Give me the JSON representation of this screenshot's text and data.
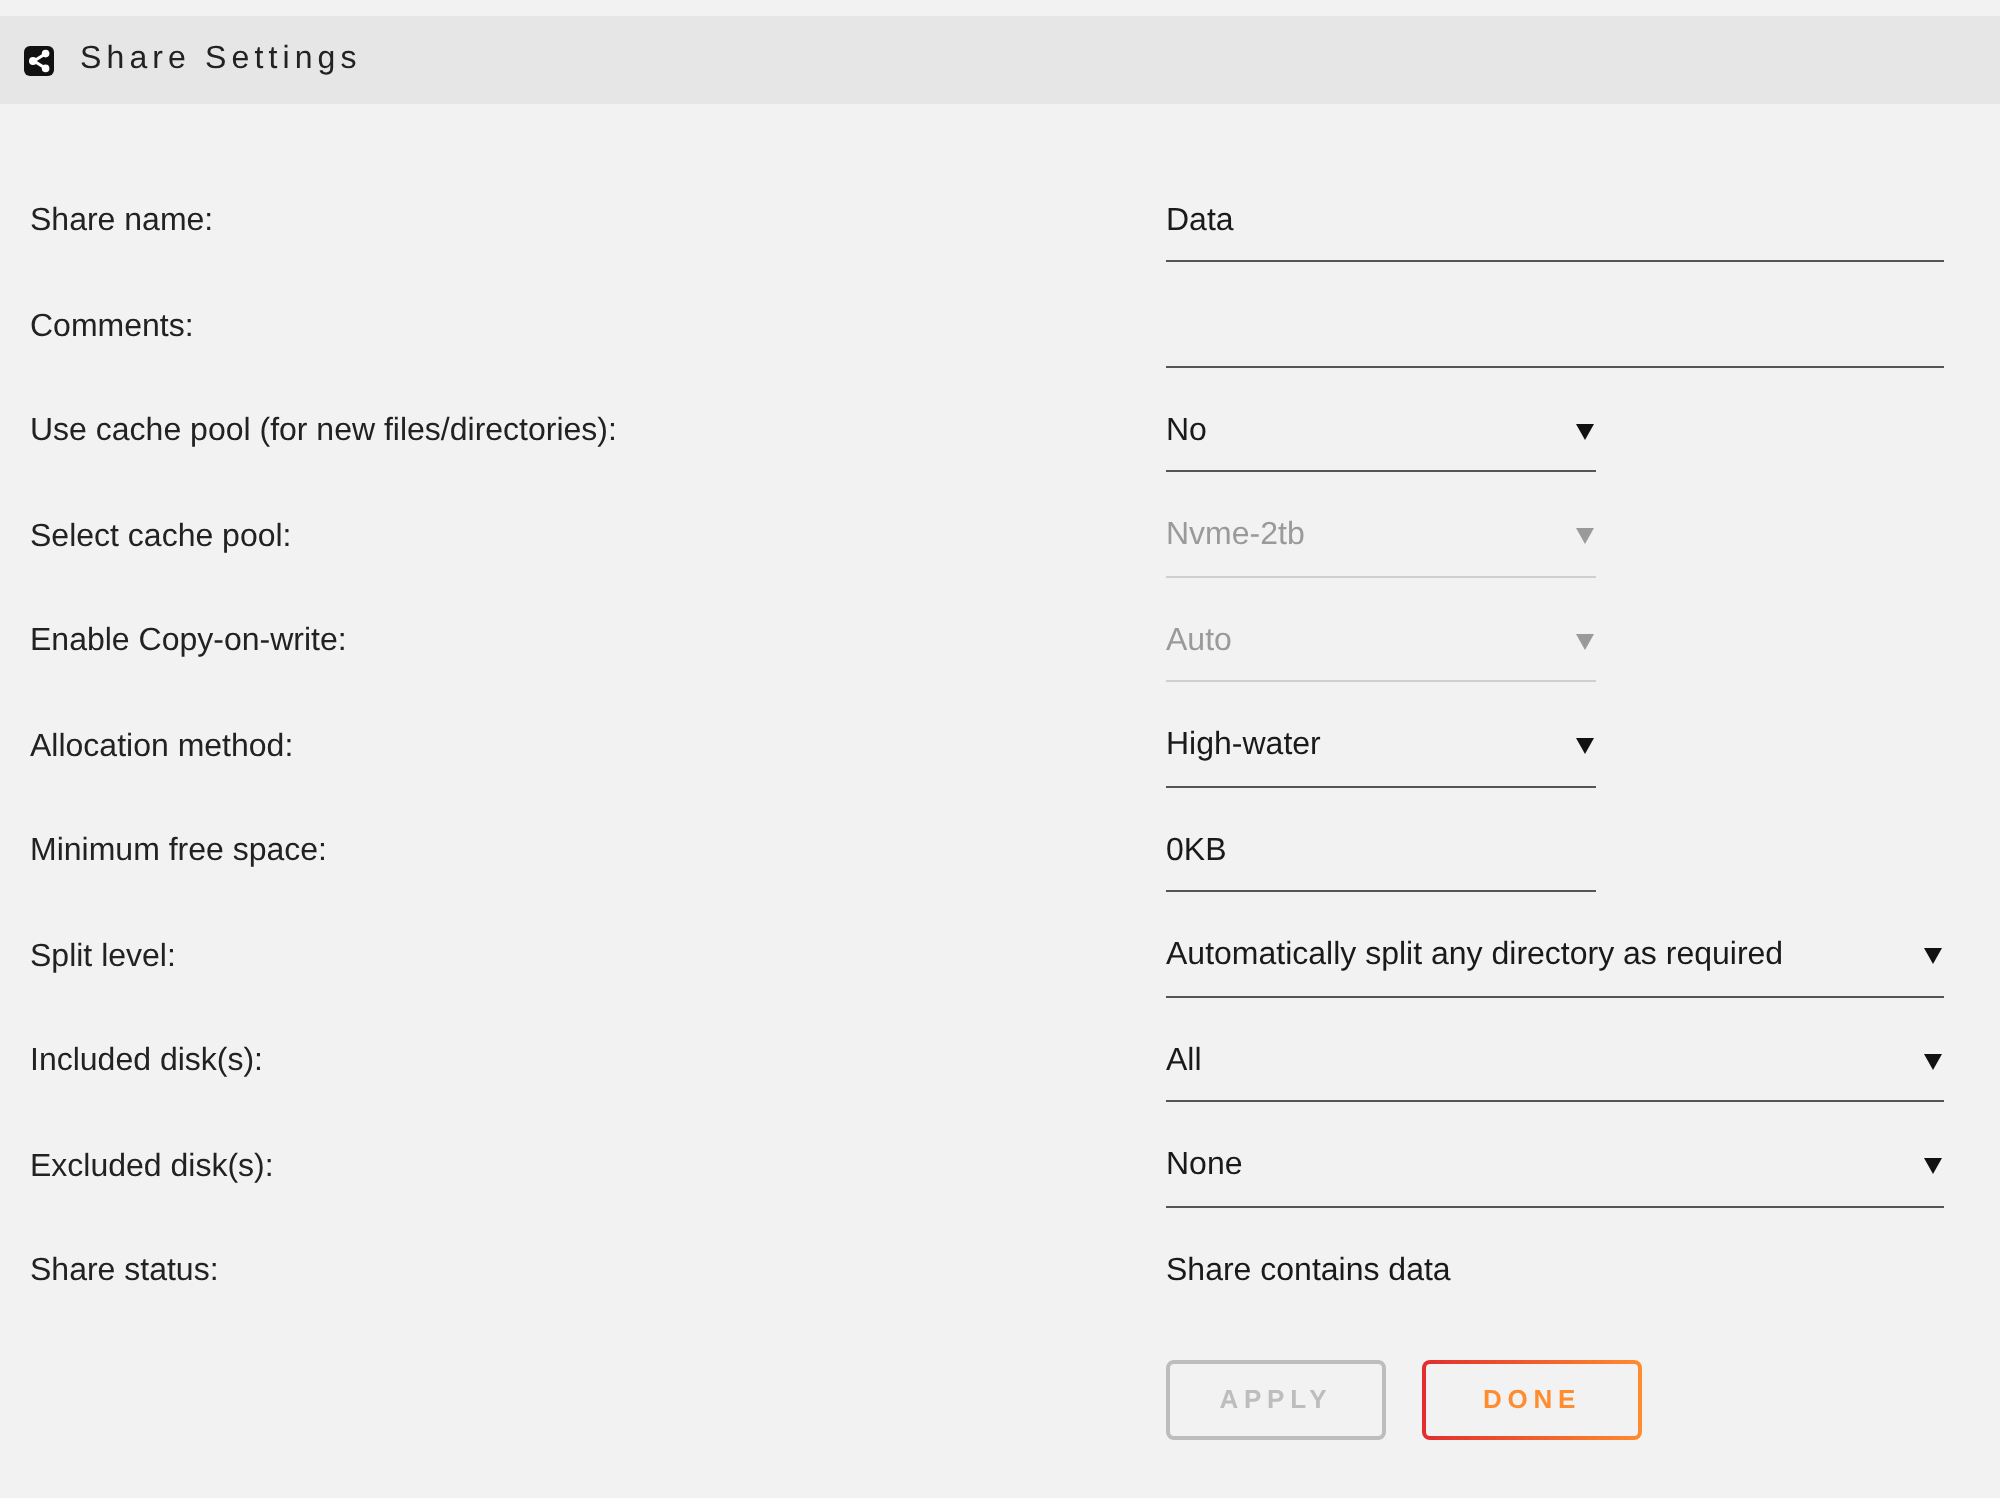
{
  "panel": {
    "title": "Share Settings"
  },
  "fields": [
    {
      "kind": "text",
      "label": "Share name:",
      "value": "Data",
      "disabled": false
    },
    {
      "kind": "text",
      "label": "Comments:",
      "disabled": false
    },
    {
      "kind": "select",
      "label": "Use cache pool (for new files/directories):",
      "value": "No",
      "disabled": false
    },
    {
      "kind": "select",
      "label": "Select cache pool:",
      "value": "Nvme-2tb",
      "disabled": true
    },
    {
      "kind": "select",
      "label": "Enable Copy-on-write:",
      "value": "Auto",
      "disabled": true
    },
    {
      "kind": "select",
      "label": "Allocation method:",
      "value": "High-water",
      "disabled": false
    },
    {
      "kind": "text",
      "label": "Minimum free space:",
      "value": "0KB",
      "disabled": false
    },
    {
      "kind": "select",
      "label": "Split level:",
      "value": "Automatically split any directory as required",
      "disabled": false
    },
    {
      "kind": "select",
      "label": "Included disk(s):",
      "value": "All",
      "disabled": false
    },
    {
      "kind": "select",
      "label": "Excluded disk(s):",
      "value": "None",
      "disabled": false
    },
    {
      "kind": "status",
      "label": "Share status:",
      "value": "Share contains data"
    }
  ],
  "buttons": [
    {
      "kind": "apply",
      "label": "APPLY",
      "disabled": true
    },
    {
      "kind": "done",
      "label": "DONE",
      "disabled": false
    }
  ]
}
